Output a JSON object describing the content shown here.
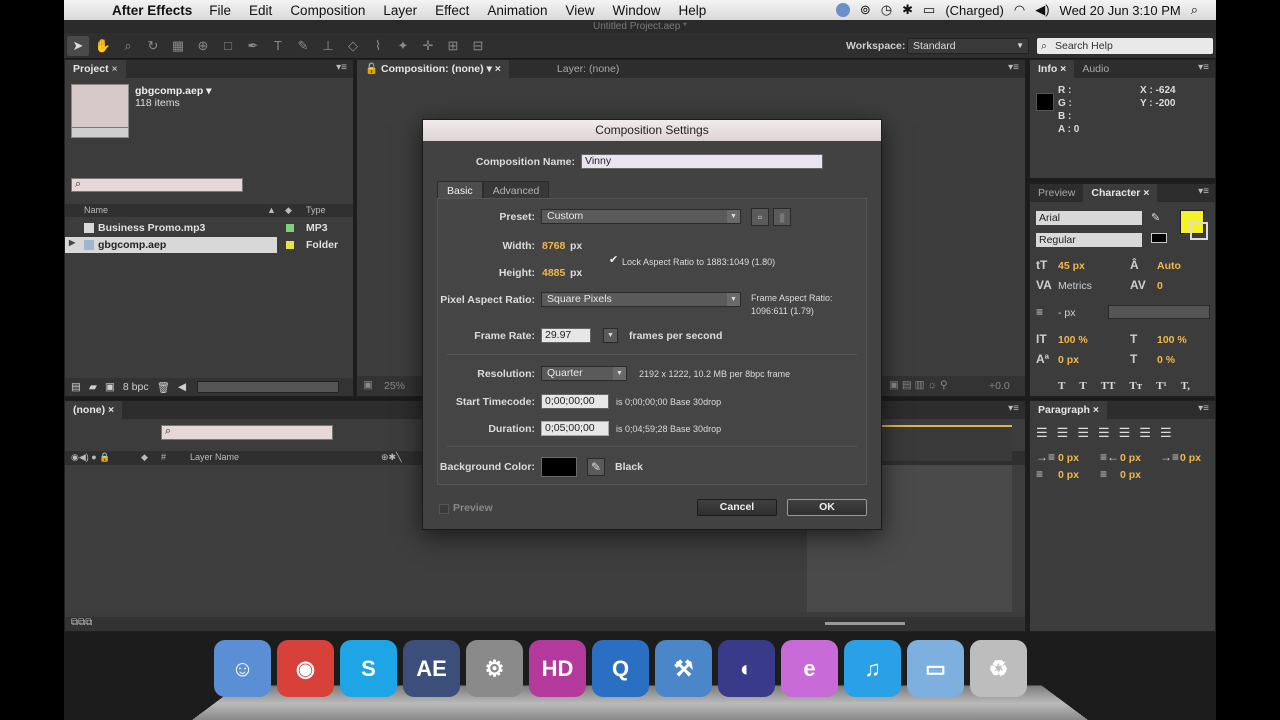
{
  "menubar": {
    "app": "After Effects",
    "items": [
      "File",
      "Edit",
      "Composition",
      "Layer",
      "Effect",
      "Animation",
      "View",
      "Window",
      "Help"
    ],
    "battery": "(Charged)",
    "datetime": "Wed 20 Jun  3:10 PM"
  },
  "window_title": "Untitled Project.aep *",
  "toolbar": {
    "workspace_label": "Workspace:",
    "workspace_value": "Standard",
    "search_help_placeholder": "Search Help"
  },
  "project": {
    "tab": "Project",
    "file_name": "gbgcomp.aep ▾",
    "item_count": "118 items",
    "columns": {
      "name": "Name",
      "type": "Type"
    },
    "rows": [
      {
        "name": "Business Promo.mp3",
        "type": "MP3",
        "label_color": "#7fd07f"
      },
      {
        "name": "gbgcomp.aep",
        "type": "Folder",
        "label_color": "#e8e24a"
      }
    ],
    "bit_depth": "8 bpc"
  },
  "viewer": {
    "comp_tab": "Composition: (none)",
    "layer_tab": "Layer: (none)",
    "zoom": "25%",
    "exposure": "+0.0"
  },
  "info": {
    "tabs": [
      "Info",
      "Audio"
    ],
    "r": "R :",
    "g": "G :",
    "b": "B :",
    "a": "A : 0",
    "x": "X : -624",
    "y": "Y : -200"
  },
  "character": {
    "tabs": [
      "Preview",
      "Character"
    ],
    "font": "Arial",
    "style": "Regular",
    "size": "45 px",
    "leading": "Auto",
    "kerning": "Metrics",
    "tracking": "0",
    "stroke": "- px",
    "vscale": "100 %",
    "hscale": "100 %",
    "baseline": "0 px",
    "tsume": "0 %",
    "fill_color": "#f5f229",
    "type_buttons": [
      "T",
      "T",
      "TT",
      "Tт",
      "T¹",
      "T,"
    ]
  },
  "paragraph": {
    "tab": "Paragraph",
    "indents": [
      "0 px",
      "0 px",
      "0 px",
      "0 px",
      "0 px"
    ]
  },
  "timeline": {
    "tab": "(none)",
    "layer_name_col": "Layer Name"
  },
  "dialog": {
    "title": "Composition Settings",
    "comp_name_label": "Composition Name:",
    "comp_name": "Vinny",
    "tabs": [
      "Basic",
      "Advanced"
    ],
    "preset_label": "Preset:",
    "preset": "Custom",
    "width_label": "Width:",
    "width": "8768",
    "height_label": "Height:",
    "height": "4885",
    "px": "px",
    "lock_aspect": "Lock Aspect Ratio to 1883:1049 (1.80)",
    "par_label": "Pixel Aspect Ratio:",
    "par": "Square Pixels",
    "frame_aspect_label": "Frame Aspect Ratio:",
    "frame_aspect": "1096:611 (1.79)",
    "fps_label": "Frame Rate:",
    "fps": "29.97",
    "fps_unit": "frames per second",
    "resolution_label": "Resolution:",
    "resolution": "Quarter",
    "resolution_info": "2192 x 1222, 10.2 MB per 8bpc frame",
    "start_tc_label": "Start Timecode:",
    "start_tc": "0;00;00;00",
    "start_tc_info": "is 0;00;00;00  Base 30drop",
    "duration_label": "Duration:",
    "duration": "0;05;00;00",
    "duration_info": "is 0;04;59;28  Base 30drop",
    "bg_label": "Background Color:",
    "bg_name": "Black",
    "preview": "Preview",
    "cancel": "Cancel",
    "ok": "OK"
  },
  "dock": [
    {
      "name": "finder-icon",
      "label": "☺",
      "color": "#5a8fd6"
    },
    {
      "name": "chrome-icon",
      "label": "◉",
      "color": "#d8413a"
    },
    {
      "name": "skype-icon",
      "label": "S",
      "color": "#1ea5e6"
    },
    {
      "name": "after-effects-icon",
      "label": "AE",
      "color": "#3c4f7a"
    },
    {
      "name": "system-preferences-icon",
      "label": "⚙",
      "color": "#8a8a8a"
    },
    {
      "name": "hd-video-icon",
      "label": "HD",
      "color": "#b3399c"
    },
    {
      "name": "quicktime-icon",
      "label": "Q",
      "color": "#2a6fc2"
    },
    {
      "name": "xcode-icon",
      "label": "⚒",
      "color": "#4b86c9"
    },
    {
      "name": "eclipse-icon",
      "label": "◐",
      "color": "#3a3a8a"
    },
    {
      "name": "emacs-icon",
      "label": "e",
      "color": "#c86ad8"
    },
    {
      "name": "itunes-icon",
      "label": "♫",
      "color": "#2aa0e6"
    },
    {
      "name": "applications-folder-icon",
      "label": "▭",
      "color": "#7db0de"
    },
    {
      "name": "trash-icon",
      "label": "♻",
      "color": "#bdbdbd"
    }
  ]
}
